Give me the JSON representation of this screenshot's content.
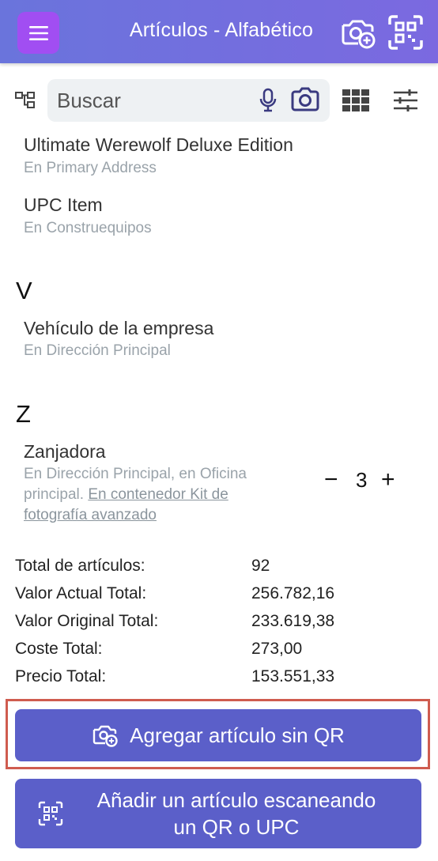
{
  "header": {
    "title": "Artículos - Alfabético",
    "accent": "#6a74dc",
    "menu_color": "#a14ef2",
    "icons": [
      "menu-icon",
      "camera-add-icon",
      "qr-scan-icon"
    ]
  },
  "search": {
    "placeholder": "Buscar",
    "icons": [
      "tree-view-icon",
      "microphone-icon",
      "camera-icon",
      "grid-view-icon",
      "filter-sliders-icon"
    ]
  },
  "items": [
    {
      "name": "Ultimate Werewolf Deluxe Edition",
      "location": "En Primary Address"
    },
    {
      "name": "UPC Item",
      "location": "En Construequipos"
    }
  ],
  "sections": [
    {
      "letter": "V",
      "items": [
        {
          "name": "Vehículo de la empresa",
          "location": "En Dirección Principal"
        }
      ]
    },
    {
      "letter": "Z",
      "items": [
        {
          "name": "Zanjadora",
          "location_line1": "En Dirección Principal, en Oficina",
          "location_line2_prefix": "principal.",
          "container_link_part1": "En contenedor Kit de",
          "container_link_part2": "fotografía avanzado",
          "quantity": "3",
          "minus": "−",
          "plus": "+"
        }
      ]
    }
  ],
  "summary": [
    {
      "label": "Total de artículos:",
      "value": "92"
    },
    {
      "label": "Valor Actual Total:",
      "value": "256.782,16"
    },
    {
      "label": "Valor Original Total:",
      "value": "233.619,38"
    },
    {
      "label": "Coste Total:",
      "value": "273,00"
    },
    {
      "label": "Precio Total:",
      "value": "153.551,33"
    }
  ],
  "buttons": {
    "add_without_qr": "Agregar artículo sin QR",
    "add_scan_line1": "Añadir un artículo escaneando",
    "add_scan_line2": "un QR o UPC",
    "button_color": "#5b5fc9",
    "highlight_color": "#cf5c4f"
  }
}
